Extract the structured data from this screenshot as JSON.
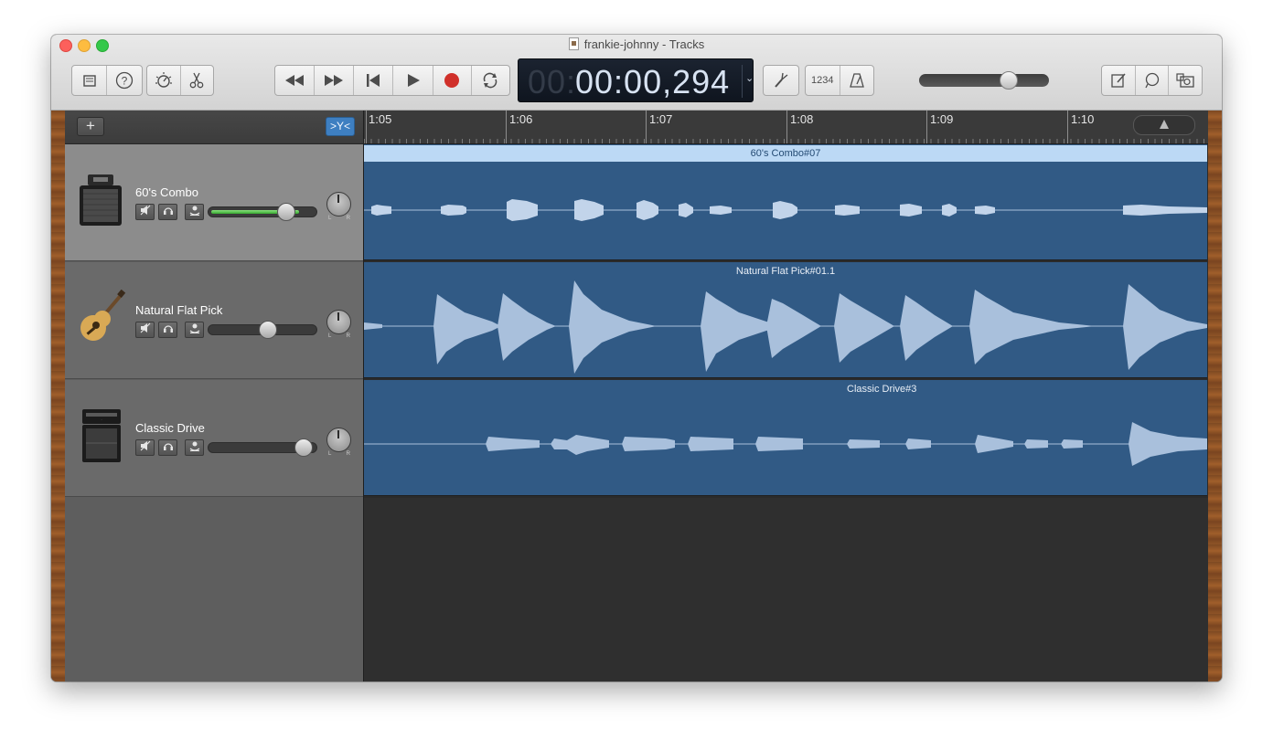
{
  "window": {
    "title": "frankie-johnny - Tracks"
  },
  "toolbar": {
    "library": "library-icon",
    "help": "?",
    "smart_controls": "smart-controls-icon",
    "editors": "scissors-icon",
    "rewind": "◀◀",
    "forward": "▶▶",
    "go_to_start": "start-icon",
    "play": "▶",
    "record": "record-icon",
    "cycle": "cycle-icon",
    "lcd_prefix": "00:",
    "lcd_time": "00:00,294",
    "lcd_dropdown": "⌄",
    "tuner": "tuner-icon",
    "count_in": "1234",
    "metronome": "metronome-icon",
    "master_volume": 0.7,
    "notepad": "notepad-icon",
    "loop_browser": "loop-icon",
    "media_browser": "media-icon"
  },
  "tracks_header": {
    "add": "+",
    "catch": ">Y<"
  },
  "ruler": {
    "labels": [
      "1:05",
      "1:06",
      "1:07",
      "1:08",
      "1:09",
      "1:10"
    ]
  },
  "tracks": [
    {
      "name": "60's Combo",
      "region": "60's Combo#07",
      "volume": 0.72,
      "selected": true
    },
    {
      "name": "Natural Flat Pick",
      "region": "Natural Flat Pick#01.1",
      "volume": 0.55,
      "selected": false
    },
    {
      "name": "Classic Drive",
      "region": "Classic Drive#3",
      "volume": 0.88,
      "selected": false
    }
  ],
  "colors": {
    "region": "#315a85",
    "waveform": "#a9c0dc",
    "selected_label": "#bcd9f5",
    "accent": "#3e7fc1",
    "record": "#d0302a"
  }
}
